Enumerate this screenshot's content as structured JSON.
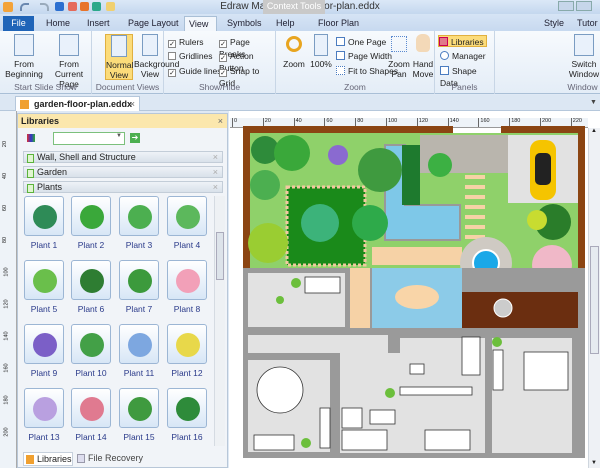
{
  "app": {
    "title": "Edraw Max - garden-floor-plan.eddx",
    "context_tools": "Context Tools"
  },
  "menu_tabs": [
    "File",
    "Home",
    "Insert",
    "Page Layout",
    "View",
    "Symbols",
    "Help",
    "Floor Plan"
  ],
  "right_menu": {
    "style": "Style",
    "tutor": "Tutor"
  },
  "ribbon": {
    "start_slide_show": {
      "label": "Start Slide Show",
      "from_beginning": "From Beginning",
      "from_current": "From Current Page"
    },
    "document_views": {
      "label": "Document Views",
      "normal": "Normal View",
      "background": "Background View"
    },
    "show_hide": {
      "label": "Show/Hide",
      "items": [
        {
          "label": "Rulers",
          "checked": true
        },
        {
          "label": "Gridlines",
          "checked": false
        },
        {
          "label": "Guide lines",
          "checked": true
        },
        {
          "label": "Page Breaks",
          "checked": true
        },
        {
          "label": "Action Button",
          "checked": true
        },
        {
          "label": "Snap to Grid",
          "checked": true
        }
      ]
    },
    "zoom": {
      "label": "Zoom",
      "zoom": "Zoom",
      "hundred": "100%",
      "one_page": "One Page",
      "page_width": "Page Width",
      "fit": "Fit to Shapes",
      "zoom_pan": "Zoom Pan",
      "hand_move": "Hand Move"
    },
    "panels": {
      "label": "Panels",
      "libraries": "Libraries",
      "manager": "Manager",
      "shape_data": "Shape Data"
    },
    "window": {
      "label": "Window",
      "switch": "Switch Window"
    }
  },
  "document_tab": "garden-floor-plan.eddx",
  "libraries": {
    "title": "Libraries",
    "search_value": "",
    "categories": [
      "Wall, Shell and Structure",
      "Garden",
      "Plants"
    ],
    "plants": [
      "Plant 1",
      "Plant 2",
      "Plant 3",
      "Plant 4",
      "Plant 5",
      "Plant 6",
      "Plant 7",
      "Plant 8",
      "Plant 9",
      "Plant 10",
      "Plant 11",
      "Plant 12",
      "Plant 13",
      "Plant 14",
      "Plant 15",
      "Plant 16"
    ],
    "bottom_tabs": [
      "Libraries",
      "File Recovery"
    ]
  },
  "rulers": {
    "top": [
      "0",
      "20",
      "40",
      "60",
      "80",
      "100",
      "120",
      "140",
      "160",
      "180",
      "200",
      "220"
    ],
    "left": [
      "20",
      "40",
      "60",
      "80",
      "100",
      "120",
      "140",
      "160",
      "180",
      "200"
    ]
  }
}
